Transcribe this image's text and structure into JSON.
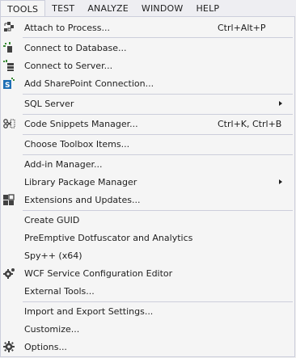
{
  "menubar": {
    "items": [
      "TOOLS",
      "TEST",
      "ANALYZE",
      "WINDOW",
      "HELP"
    ]
  },
  "menu": {
    "attach": {
      "label": "Attach to Process...",
      "shortcut": "Ctrl+Alt+P",
      "icon": "attach-process-icon"
    },
    "connect_db": {
      "label": "Connect to Database...",
      "icon": "database-icon"
    },
    "connect_server": {
      "label": "Connect to Server...",
      "icon": "server-icon"
    },
    "sharepoint": {
      "label": "Add SharePoint Connection...",
      "icon": "sharepoint-icon"
    },
    "sql_server": {
      "label": "SQL Server"
    },
    "snippets": {
      "label": "Code Snippets Manager...",
      "shortcut": "Ctrl+K, Ctrl+B",
      "icon": "snippets-icon"
    },
    "toolbox": {
      "label": "Choose Toolbox Items..."
    },
    "addin": {
      "label": "Add-in Manager..."
    },
    "library": {
      "label": "Library Package Manager"
    },
    "extensions": {
      "label": "Extensions and Updates...",
      "icon": "extensions-icon"
    },
    "guid": {
      "label": "Create GUID"
    },
    "dotfuscator": {
      "label": "PreEmptive Dotfuscator and Analytics"
    },
    "spy": {
      "label": "Spy++ (x64)"
    },
    "wcf": {
      "label": "WCF Service Configuration Editor",
      "icon": "gear-icon"
    },
    "external": {
      "label": "External Tools..."
    },
    "import_export": {
      "label": "Import and Export Settings..."
    },
    "customize": {
      "label": "Customize..."
    },
    "options": {
      "label": "Options...",
      "icon": "gear-icon"
    }
  }
}
